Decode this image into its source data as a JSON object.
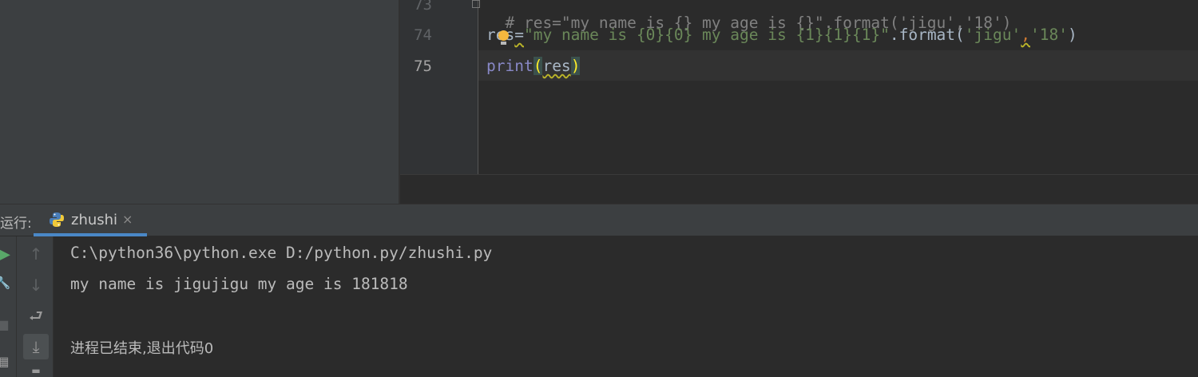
{
  "editor": {
    "line_numbers": [
      "73",
      "74",
      "75"
    ],
    "line73": {
      "comment": "# res=\"my name is {} my age is {}\".format('jigu','18')"
    },
    "line74": {
      "var": "res",
      "eq": "=",
      "str": "\"my name is {0}{0} my age is {1}{1}{1}\"",
      "method": ".format(",
      "arg1": "'jigu'",
      "comma": ",",
      "arg2": "'18'",
      "close": ")"
    },
    "line75": {
      "fn": "print",
      "open": "(",
      "arg": "res",
      "close": ")"
    }
  },
  "run_panel": {
    "label": "运行:",
    "tab_label": "zhushi",
    "tab_close": "×",
    "tab_icon": "python-icon"
  },
  "console": {
    "lines": [
      "C:\\python36\\python.exe D:/python.py/zhushi.py",
      "my name is jigujigu my age is 181818",
      "",
      "进程已结束,退出代码0"
    ]
  },
  "toolbar": {
    "icons": [
      "run-icon",
      "wrench-icon",
      "stop-icon",
      "layout-icon",
      "up-arrow-icon",
      "down-arrow-icon",
      "soft-wrap-icon",
      "scroll-to-end-icon",
      "minus-icon"
    ],
    "glyphs": {
      "run": "▶",
      "wrench": "🔧",
      "stop": "■",
      "layout": "▦",
      "up": "↑",
      "down": "↓",
      "wrap": "⮐",
      "scroll_end": "⤓",
      "minus": "▬"
    }
  },
  "colors": {
    "background": "#2b2b2b",
    "panel": "#3c3f41",
    "string": "#6a8759",
    "comment": "#808080",
    "builtin": "#8888c6",
    "run_green": "#59a869",
    "tab_underline": "#4a88c7"
  }
}
